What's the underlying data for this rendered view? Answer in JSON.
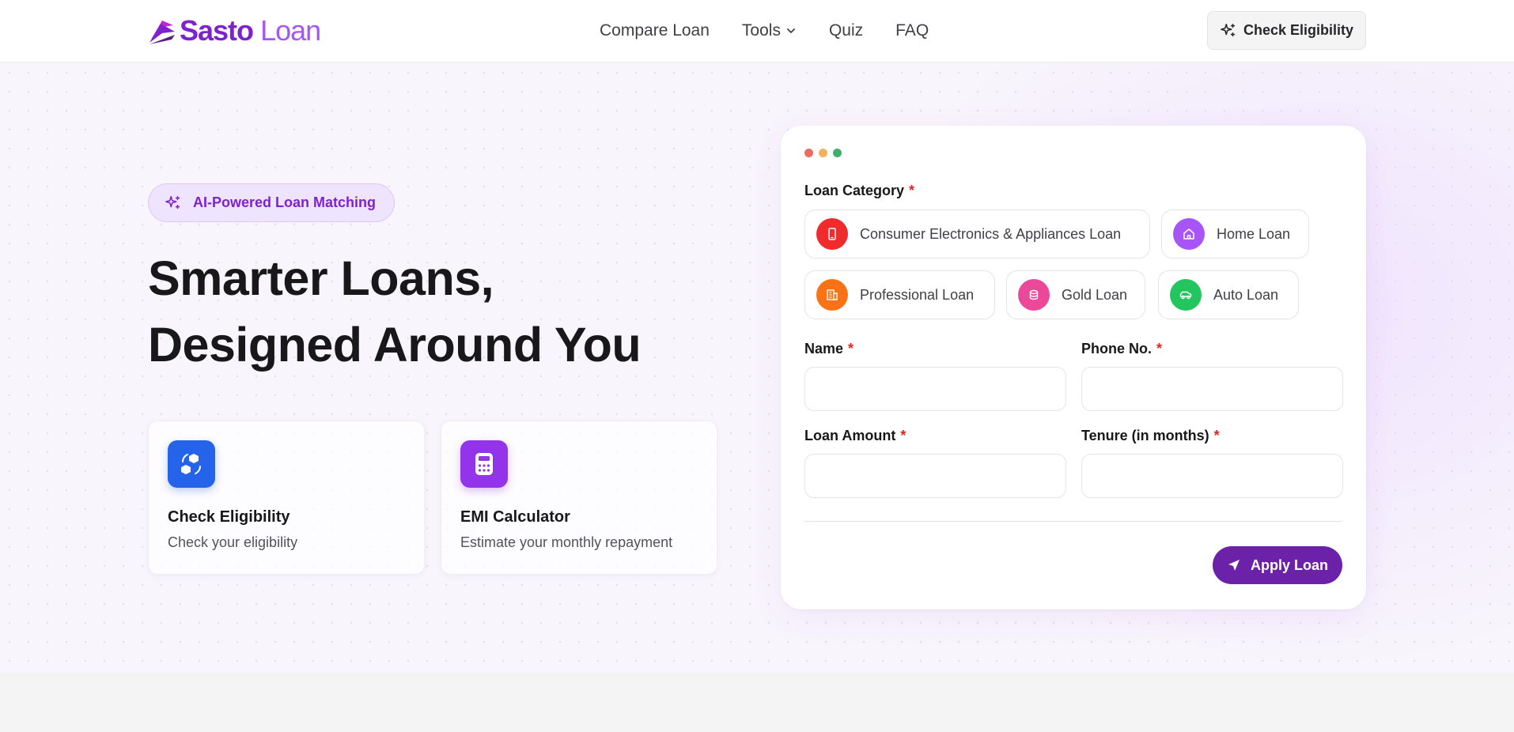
{
  "header": {
    "logo": {
      "part1": "Sasto",
      "part2": "Loan"
    },
    "nav": [
      {
        "label": "Compare Loan"
      },
      {
        "label": "Tools",
        "has_dropdown": true
      },
      {
        "label": "Quiz"
      },
      {
        "label": "FAQ"
      }
    ],
    "cta_label": "Check Eligibility"
  },
  "hero": {
    "badge": "AI-Powered Loan Matching",
    "title_line1": "Smarter Loans,",
    "title_line2": "Designed Around You",
    "features": [
      {
        "title": "Check Eligibility",
        "desc": "Check your eligibility",
        "icon": "cubes-exchange-icon",
        "color": "#2563eb"
      },
      {
        "title": "EMI Calculator",
        "desc": "Estimate your monthly repayment",
        "icon": "calculator-icon",
        "color": "#9333ea"
      }
    ]
  },
  "form": {
    "window_dots": [
      "#ef6b5b",
      "#f0b35a",
      "#3fb06a"
    ],
    "category_label": "Loan Category",
    "required_mark": "*",
    "categories": [
      {
        "label": "Consumer Electronics & Appliances Loan",
        "icon": "phone-icon",
        "color": "#ef2b2b"
      },
      {
        "label": "Home Loan",
        "icon": "home-icon",
        "color": "#a855f7"
      },
      {
        "label": "Professional Loan",
        "icon": "building-icon",
        "color": "#f97316"
      },
      {
        "label": "Gold Loan",
        "icon": "gold-coin-icon",
        "color": "#ec4899"
      },
      {
        "label": "Auto Loan",
        "icon": "car-icon",
        "color": "#22c55e"
      }
    ],
    "fields": {
      "name": {
        "label": "Name",
        "value": "",
        "placeholder": ""
      },
      "phone": {
        "label": "Phone No.",
        "value": "",
        "placeholder": ""
      },
      "amount": {
        "label": "Loan Amount",
        "value": "",
        "placeholder": ""
      },
      "tenure": {
        "label": "Tenure (in months)",
        "value": "",
        "placeholder": ""
      }
    },
    "submit_label": "Apply Loan"
  }
}
